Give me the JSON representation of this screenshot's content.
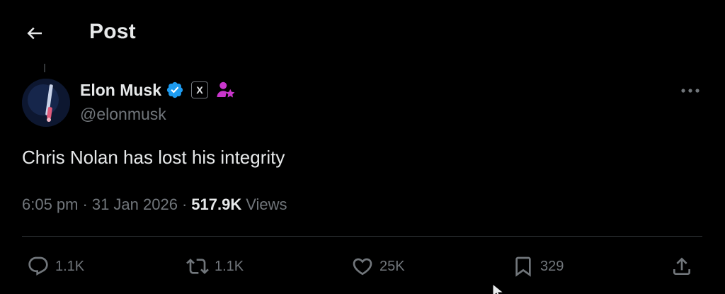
{
  "header": {
    "title": "Post",
    "back_icon": "arrow-left-icon"
  },
  "author": {
    "display_name": "Elon Musk",
    "handle": "@elonmusk",
    "verified_icon": "verified-badge-icon",
    "verified_color": "#1d9bf0",
    "affiliation_badge": "X",
    "subscription_icon": "person-star-icon",
    "subscription_color": "#c936cc"
  },
  "tweet": {
    "text": "Chris Nolan has lost his integrity",
    "time": "6:05 pm",
    "date": "31 Jan 2026",
    "views_count": "517.9K",
    "views_label": "Views",
    "separator": "·"
  },
  "actions": {
    "reply_count": "1.1K",
    "repost_count": "1.1K",
    "like_count": "25K",
    "bookmark_count": "329"
  },
  "colors": {
    "background": "#000000",
    "text_primary": "#e7e9ea",
    "text_secondary": "#71767b",
    "divider": "#2f3336"
  }
}
